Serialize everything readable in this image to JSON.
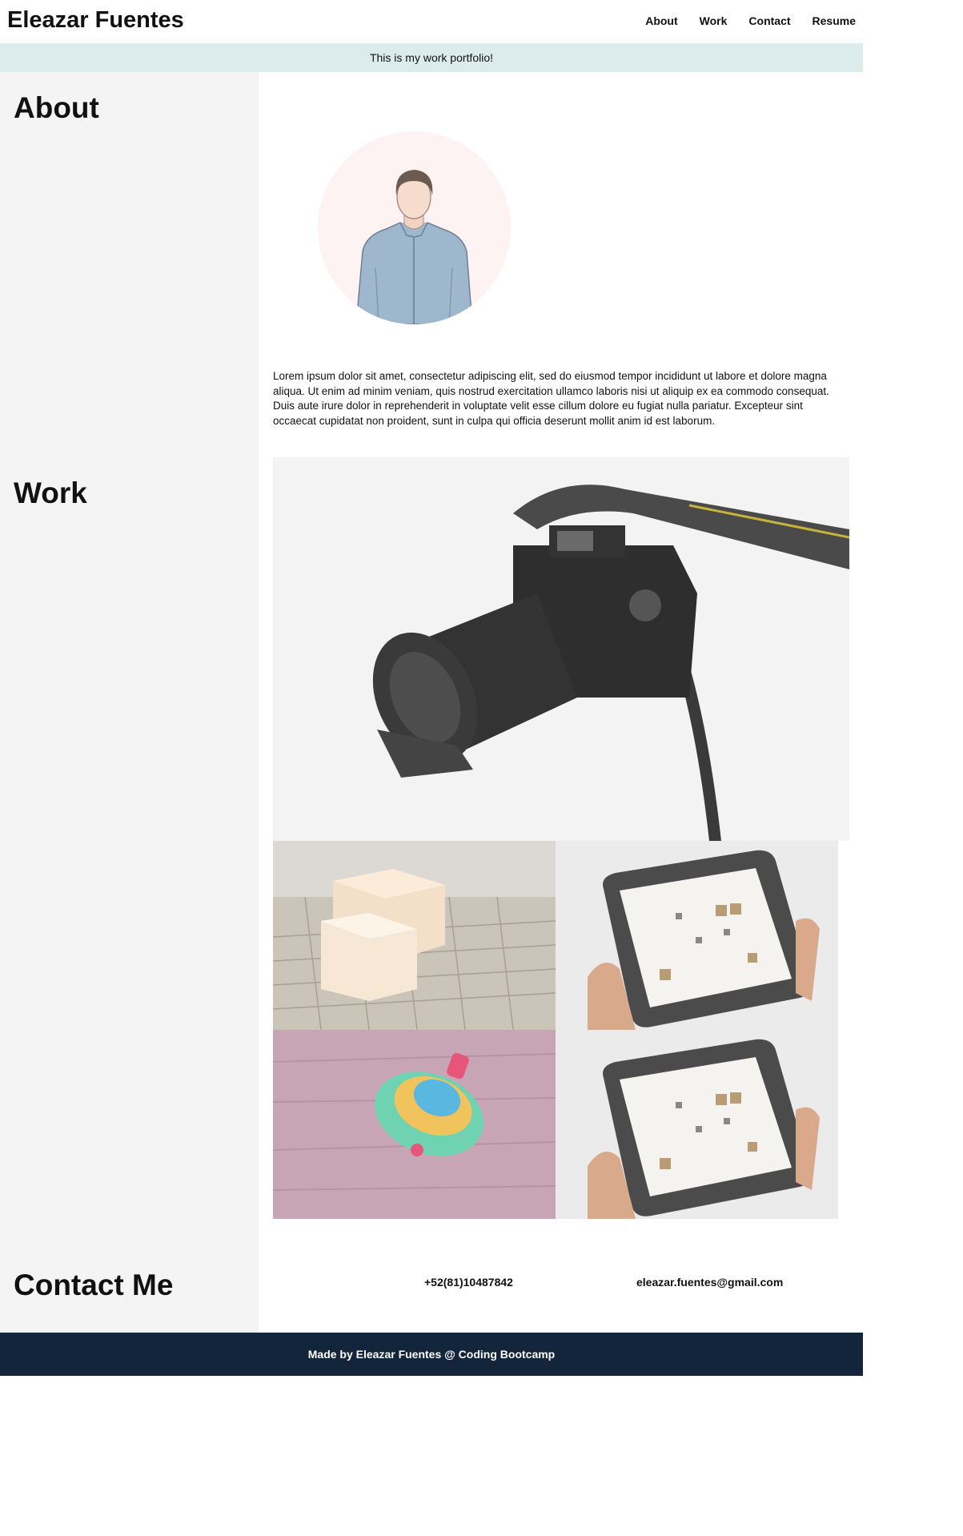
{
  "header": {
    "brand": "Eleazar Fuentes",
    "nav": [
      "About",
      "Work",
      "Contact",
      "Resume"
    ]
  },
  "banner": "This is my work portfolio!",
  "about": {
    "heading": "About",
    "bio": "Lorem ipsum dolor sit amet, consectetur adipiscing elit, sed do eiusmod tempor incididunt ut labore et dolore magna aliqua. Ut enim ad minim veniam, quis nostrud exercitation ullamco laboris nisi ut aliquip ex ea commodo consequat. Duis aute irure dolor in reprehenderit in voluptate velit esse cillum dolore eu fugiat nulla pariatur. Excepteur sint occaecat cupidatat non proident, sunt in culpa qui officia deserunt mollit anim id est laborum."
  },
  "work": {
    "heading": "Work",
    "images": [
      "camera-photo",
      "soap-bars-photo",
      "tablet-photo",
      "spinning-top-photo",
      "tablet-photo"
    ]
  },
  "contact": {
    "heading": "Contact Me",
    "phone": "+52(81)10487842",
    "email": "eleazar.fuentes@gmail.com"
  },
  "footer": "Made by Eleazar Fuentes @ Coding Bootcamp",
  "colors": {
    "banner_bg": "#dcecec",
    "sidebar_bg": "#f4f4f4",
    "footer_bg": "#13253a"
  }
}
